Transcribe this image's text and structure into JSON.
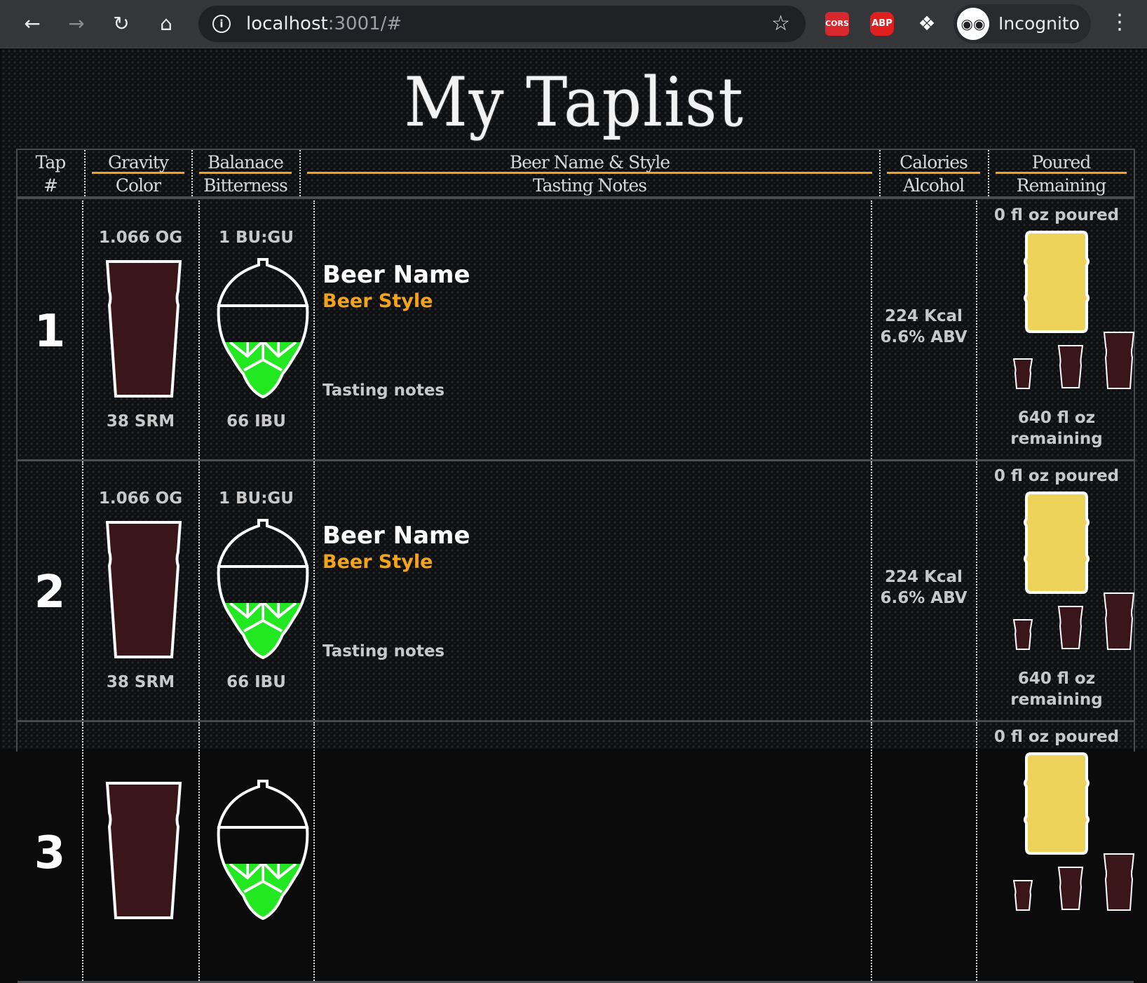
{
  "browser": {
    "url_host": "localhost",
    "url_rest": ":3001/#",
    "ext_cors": "CORS",
    "ext_abp": "ABP",
    "profile": "Incognito"
  },
  "page": {
    "title": "My Taplist"
  },
  "header": {
    "tap_top": "Tap",
    "tap_bottom": "#",
    "gravity": "Gravity",
    "color": "Color",
    "balance": "Balanace",
    "bitterness": "Bitterness",
    "name_style": "Beer Name & Style",
    "notes": "Tasting Notes",
    "calories": "Calories",
    "alcohol": "Alcohol",
    "poured": "Poured",
    "remaining": "Remaining"
  },
  "colors": {
    "accent": "#f2a51c",
    "beer": "#3a1519",
    "hop": "#22e822",
    "keg": "#eed35a"
  },
  "taps": [
    {
      "number": "1",
      "og": "1.066 OG",
      "srm": "38 SRM",
      "bugu": "1 BU:GU",
      "ibu": "66 IBU",
      "name": "Beer Name",
      "style": "Beer Style",
      "notes": "Tasting notes",
      "kcal": "224 Kcal",
      "abv": "6.6% ABV",
      "poured": "0 fl oz poured",
      "remaining_amount": "640 fl oz",
      "remaining_label": "remaining",
      "hop_fill": 0.6,
      "keg_fill": 1.0
    },
    {
      "number": "2",
      "og": "1.066 OG",
      "srm": "38 SRM",
      "bugu": "1 BU:GU",
      "ibu": "66 IBU",
      "name": "Beer Name",
      "style": "Beer Style",
      "notes": "Tasting notes",
      "kcal": "224 Kcal",
      "abv": "6.6% ABV",
      "poured": "0 fl oz poured",
      "remaining_amount": "640 fl oz",
      "remaining_label": "remaining",
      "hop_fill": 0.6,
      "keg_fill": 1.0
    },
    {
      "number": "3",
      "og": "",
      "srm": "",
      "bugu": "",
      "ibu": "",
      "name": "",
      "style": "",
      "notes": "",
      "kcal": "",
      "abv": "",
      "poured": "0 fl oz poured",
      "remaining_amount": "",
      "remaining_label": "",
      "hop_fill": 0.6,
      "keg_fill": 1.0
    }
  ]
}
